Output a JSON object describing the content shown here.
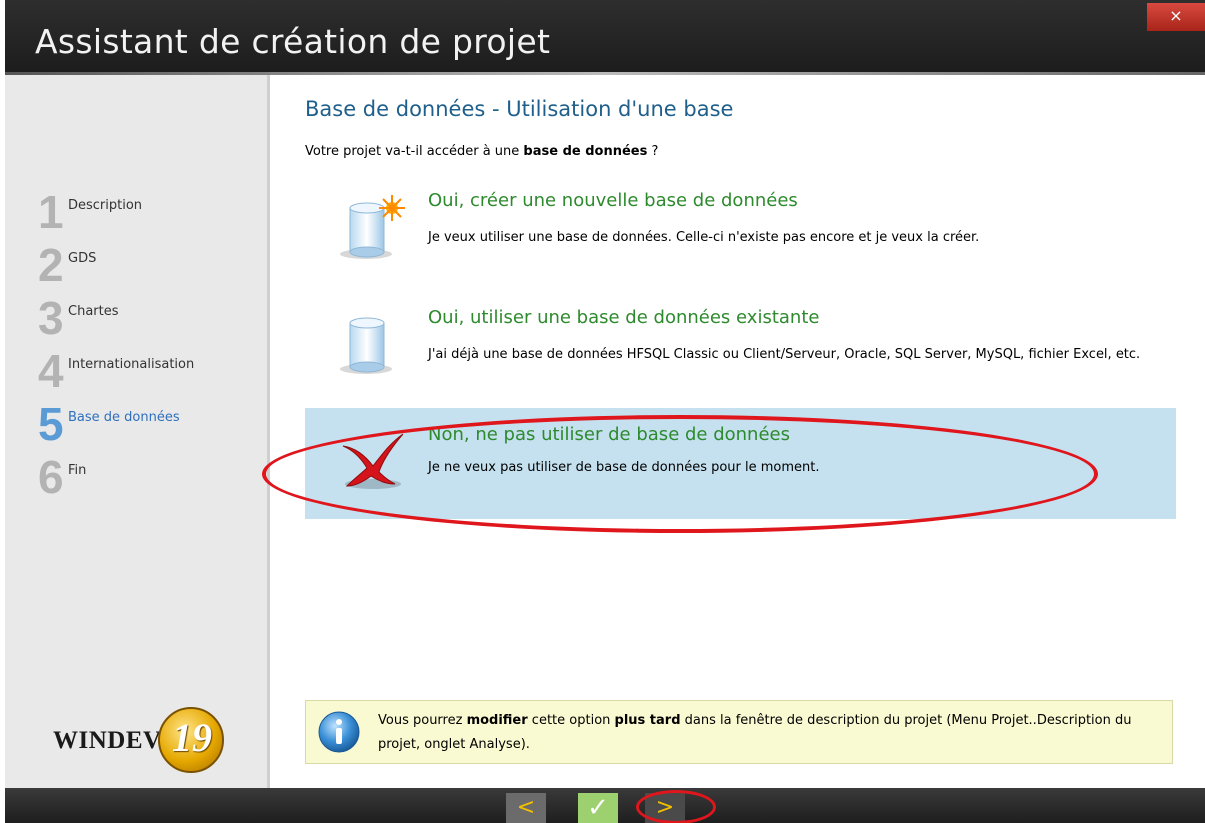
{
  "window": {
    "title": "Assistant de création de projet",
    "close_label": "×"
  },
  "sidebar": {
    "steps": [
      {
        "num": "1",
        "label": "Description"
      },
      {
        "num": "2",
        "label": "GDS"
      },
      {
        "num": "3",
        "label": "Chartes"
      },
      {
        "num": "4",
        "label": "Internationalisation"
      },
      {
        "num": "5",
        "label": "Base de données",
        "active": true
      },
      {
        "num": "6",
        "label": "Fin"
      }
    ],
    "logo": {
      "text": "WINDEV",
      "badge": "19"
    }
  },
  "main": {
    "heading": "Base de données - Utilisation d'une base",
    "question_prefix": "Votre projet va-t-il accéder à une ",
    "question_bold": "base de données",
    "question_suffix": " ?",
    "options": [
      {
        "title": "Oui, créer une nouvelle base de données",
        "desc": "Je veux utiliser une base de données. Celle-ci n'existe pas encore et je veux la créer.",
        "icon": "database-new-icon"
      },
      {
        "title": "Oui, utiliser une base de données existante",
        "desc": "J'ai déjà une base de données HFSQL Classic ou Client/Serveur, Oracle, SQL Server, MySQL, fichier Excel, etc.",
        "icon": "database-icon"
      },
      {
        "title": "Non, ne pas utiliser de base de données",
        "desc": "Je ne veux pas utiliser de base de données pour le moment.",
        "icon": "red-cross-icon",
        "selected": true
      }
    ],
    "info": {
      "t1": "Vous pourrez ",
      "b1": "modifier",
      "t2": " cette option ",
      "b2": "plus tard",
      "t3": " dans la fenêtre de description du projet (Menu Projet..Description du projet, onglet Analyse)."
    }
  },
  "nav": {
    "prev": "<",
    "ok": "✓",
    "next": ">"
  },
  "colors": {
    "accent_green": "#2d8a2d",
    "heading_blue": "#1f5f8b",
    "selected_bg": "#c5e0ee",
    "annotation_red": "#e0161d"
  }
}
